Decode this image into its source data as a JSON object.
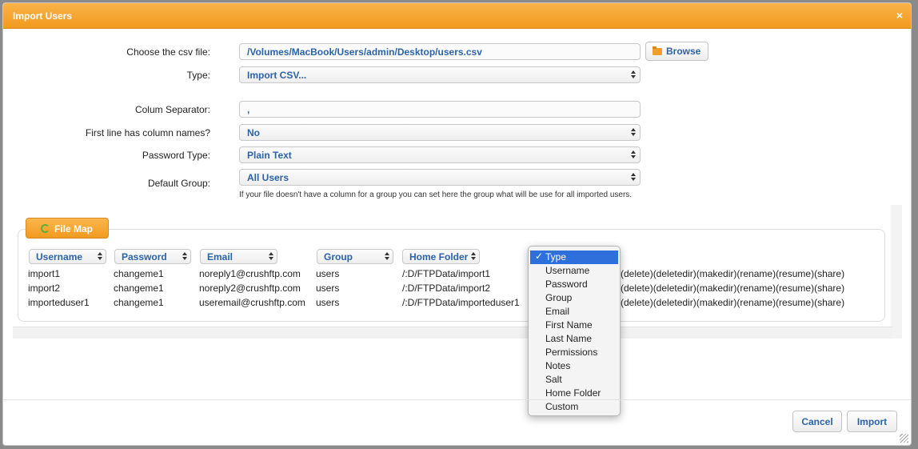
{
  "dialog": {
    "title": "Import Users",
    "close_glyph": "×"
  },
  "form": {
    "csv_label": "Choose the csv file:",
    "csv_value": "/Volumes/MacBook/Users/admin/Desktop/users.csv",
    "browse_label": "Browse",
    "type_label": "Type:",
    "type_value": "Import CSV...",
    "separator_label": "Colum Separator:",
    "separator_value": ",",
    "first_line_label": "First line has column names?",
    "first_line_value": "No",
    "password_type_label": "Password Type:",
    "password_type_value": "Plain Text",
    "default_group_label": "Default Group:",
    "default_group_value": "All Users",
    "default_group_hint": "If your file doesn't have a column for a group you can set here the group what will be use for all imported users."
  },
  "file_map": {
    "button_label": "File Map",
    "columns": [
      "Username",
      "Password",
      "Email",
      "Group",
      "Home Folder"
    ],
    "rows": [
      [
        "import1",
        "changeme1",
        "noreply1@crushftp.com",
        "users",
        "/:D/FTPData/import1",
        "(delete)(deletedir)(makedir)(rename)(resume)(share)"
      ],
      [
        "import2",
        "changeme1",
        "noreply2@crushftp.com",
        "users",
        "/:D/FTPData/import2",
        "(delete)(deletedir)(makedir)(rename)(resume)(share)"
      ],
      [
        "importeduser1",
        "changeme1",
        "useremail@crushftp.com",
        "users",
        "/:D/FTPData/importeduser1",
        "(delete)(deletedir)(makedir)(rename)(resume)(share)"
      ]
    ]
  },
  "dropdown": {
    "selected": "Type",
    "options": [
      "Type",
      "Username",
      "Password",
      "Group",
      "Email",
      "First Name",
      "Last Name",
      "Permissions",
      "Notes",
      "Salt",
      "Home Folder",
      "Custom"
    ]
  },
  "footer": {
    "cancel_label": "Cancel",
    "import_label": "Import"
  },
  "icons": {
    "close": "close-icon",
    "browse": "folder-open-icon",
    "file_map": "refresh-icon",
    "check": "checkmark-icon",
    "resize": "resize-grip-icon"
  },
  "colors": {
    "accent": "#f19a1f",
    "link": "#2a63a8",
    "selection": "#2f6fdb"
  }
}
